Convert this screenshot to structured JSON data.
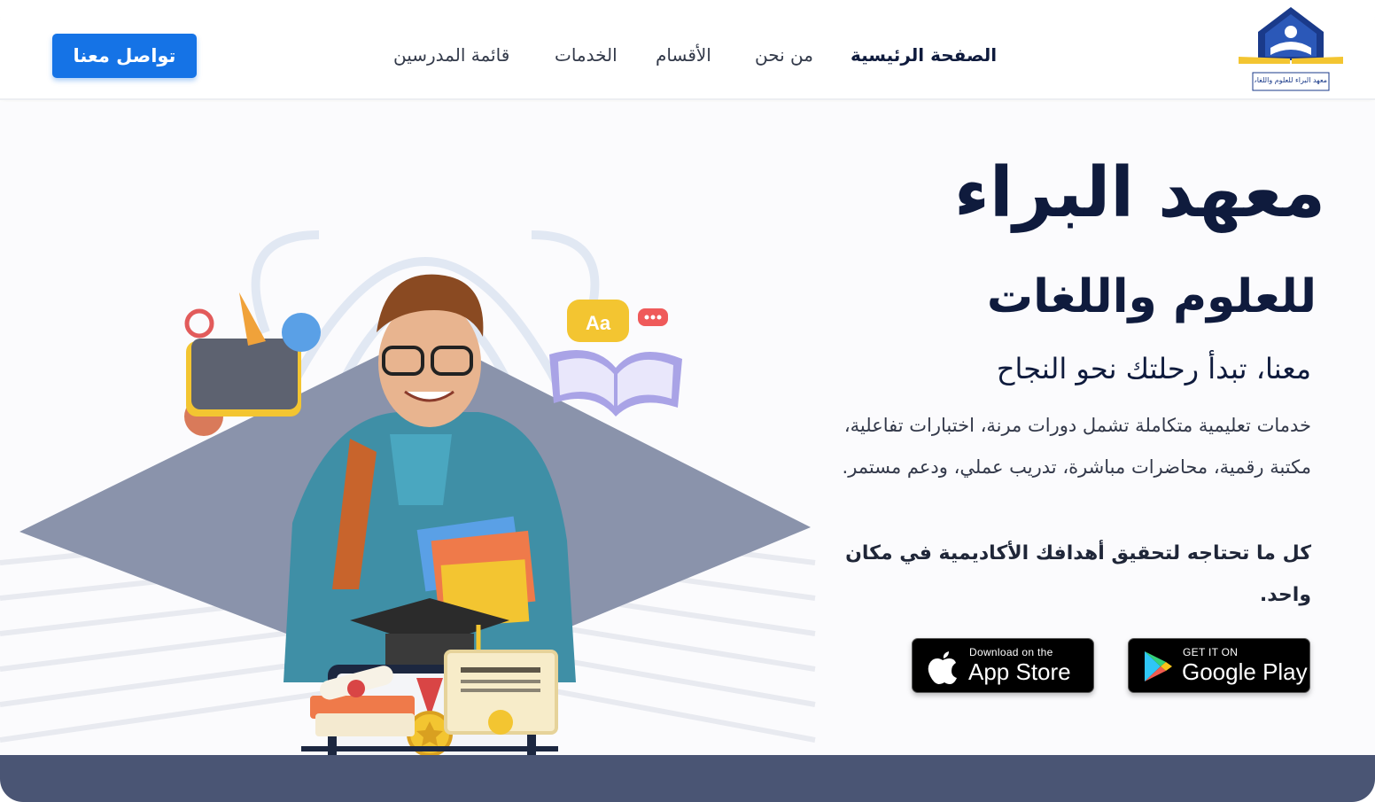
{
  "header": {
    "logo_caption": "معهد البراء للعلوم واللغات",
    "nav": [
      {
        "label": "الصفحة الرئيسية",
        "active": true
      },
      {
        "label": "من نحن",
        "active": false
      },
      {
        "label": "الأقسام",
        "active": false
      },
      {
        "label": "الخدمات",
        "active": false
      },
      {
        "label": "قائمة المدرسين",
        "active": false
      }
    ],
    "contact_label": "تواصل معنا"
  },
  "hero": {
    "title": "معهد البراء",
    "subtitle": "للعلوم واللغات",
    "tagline": "معنا، تبدأ رحلتك نحو النجاح",
    "description": "خدمات تعليمية متكاملة تشمل دورات مرنة، اختبارات تفاعلية، مكتبة رقمية، محاضرات مباشرة، تدريب عملي، ودعم مستمر.",
    "highlight": "كل ما تحتاجه لتحقيق أهدافك الأكاديمية في مكان واحد.",
    "illustration_bubble_text": "Aa"
  },
  "stores": {
    "google_play": {
      "small": "GET IT ON",
      "big": "Google Play"
    },
    "app_store": {
      "small": "Download on the",
      "big": "App Store"
    }
  },
  "colors": {
    "primary_button": "#1573e6",
    "heading": "#0f1b3d",
    "footer_band": "#4a5574",
    "diamond": "#8a93ab"
  },
  "icons": [
    "logo-emblem",
    "apple-icon",
    "google-play-icon",
    "graduation-cap-icon",
    "medal-icon",
    "certificate-icon",
    "book-icon",
    "speech-bubble-icon"
  ]
}
